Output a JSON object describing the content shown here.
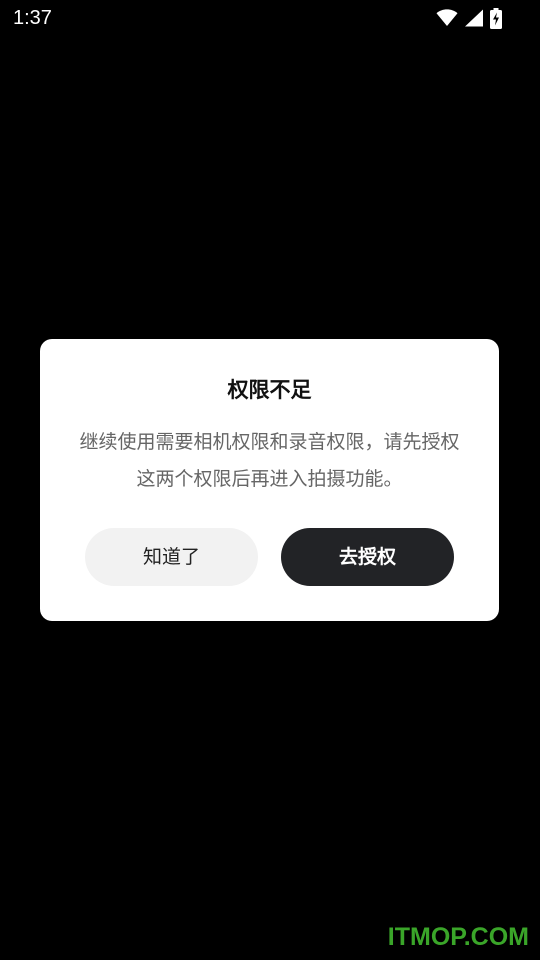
{
  "status_bar": {
    "time": "1:37",
    "icons": [
      "wifi-icon",
      "cellular-signal-icon",
      "battery-charging-icon"
    ]
  },
  "dialog": {
    "title": "权限不足",
    "message": "继续使用需要相机权限和录音权限，请先授权这两个权限后再进入拍摄功能。",
    "dismiss_button_label": "知道了",
    "authorize_button_label": "去授权"
  },
  "watermark": "ITMOP.COM",
  "colors": {
    "background": "#000000",
    "dialog_background": "#ffffff",
    "primary_button": "#222326",
    "secondary_button": "#f2f2f2",
    "watermark": "#3aa529"
  }
}
